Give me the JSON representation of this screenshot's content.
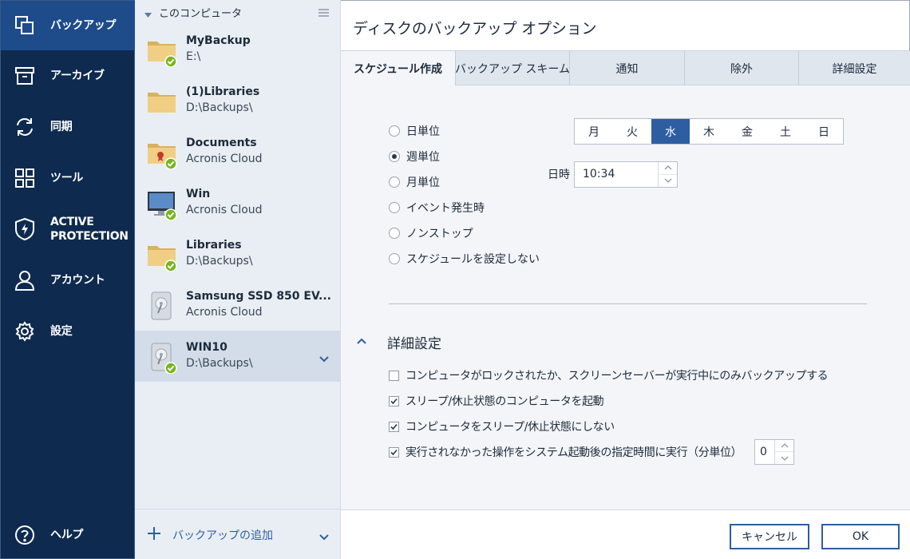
{
  "nav": {
    "items": [
      {
        "label": "バックアップ",
        "icon": "copy-icon",
        "active": true
      },
      {
        "label": "アーカイブ",
        "icon": "archive-box-icon"
      },
      {
        "label": "同期",
        "icon": "sync-arrows-icon"
      },
      {
        "label": "ツール",
        "icon": "grid-tools-icon"
      },
      {
        "label": "ACTIVE\nPROTECTION",
        "icon": "shield-bolt-icon"
      },
      {
        "label": "アカウント",
        "icon": "person-icon"
      },
      {
        "label": "設定",
        "icon": "gear-icon"
      }
    ],
    "help_label": "ヘルプ"
  },
  "backup_list": {
    "header": "このコンピュータ",
    "items": [
      {
        "name": "MyBackup",
        "destination": "E:\\",
        "icon": "folder-icon",
        "status": "ok"
      },
      {
        "name": "(1)Libraries",
        "destination": "D:\\Backups\\",
        "icon": "folder-icon",
        "status": "none"
      },
      {
        "name": "Documents",
        "destination": "Acronis Cloud",
        "icon": "briefcase-icon",
        "status": "ok"
      },
      {
        "name": "Win",
        "destination": "Acronis Cloud",
        "icon": "monitor-icon",
        "status": "ok"
      },
      {
        "name": "Libraries",
        "destination": "D:\\Backups\\",
        "icon": "folder-icon",
        "status": "ok"
      },
      {
        "name": "Samsung SSD 850 EV...",
        "destination": "Acronis Cloud",
        "icon": "hard-drive-icon",
        "status": "none"
      },
      {
        "name": "WIN10",
        "destination": "D:\\Backups\\",
        "icon": "hard-drive-icon",
        "status": "ok",
        "selected": true
      }
    ],
    "add_label": "バックアップの追加"
  },
  "main": {
    "title": "ディスクのバックアップ オプション",
    "tabs": [
      "スケジュール作成",
      "バックアップ スキーム",
      "通知",
      "除外",
      "詳細設定"
    ],
    "active_tab": 0,
    "schedule": {
      "options": [
        "日単位",
        "週単位",
        "月単位",
        "イベント発生時",
        "ノンストップ",
        "スケジュールを設定しない"
      ],
      "selected": 1,
      "days": [
        "月",
        "火",
        "水",
        "木",
        "金",
        "土",
        "日"
      ],
      "selected_day": 2,
      "time_label": "日時",
      "time_value": "10:34"
    },
    "advanced": {
      "title": "詳細設定",
      "options": [
        {
          "label": "コンピュータがロックされたか、スクリーンセーバーが実行中にのみバックアップする",
          "checked": false
        },
        {
          "label": "スリープ/休止状態のコンピュータを起動",
          "checked": true
        },
        {
          "label": "コンピュータをスリープ/休止状態にしない",
          "checked": true
        },
        {
          "label": "実行されなかった操作をシステム起動後の指定時間に実行（分単位）",
          "checked": true
        }
      ],
      "delay_value": "0"
    },
    "buttons": {
      "cancel": "キャンセル",
      "ok": "OK"
    }
  },
  "colors": {
    "nav_bg": "#0e2a4f",
    "nav_active": "#1e4b8a",
    "accent": "#2e5da1",
    "status_ok": "#7ab51d",
    "folder": "#e9c678"
  }
}
